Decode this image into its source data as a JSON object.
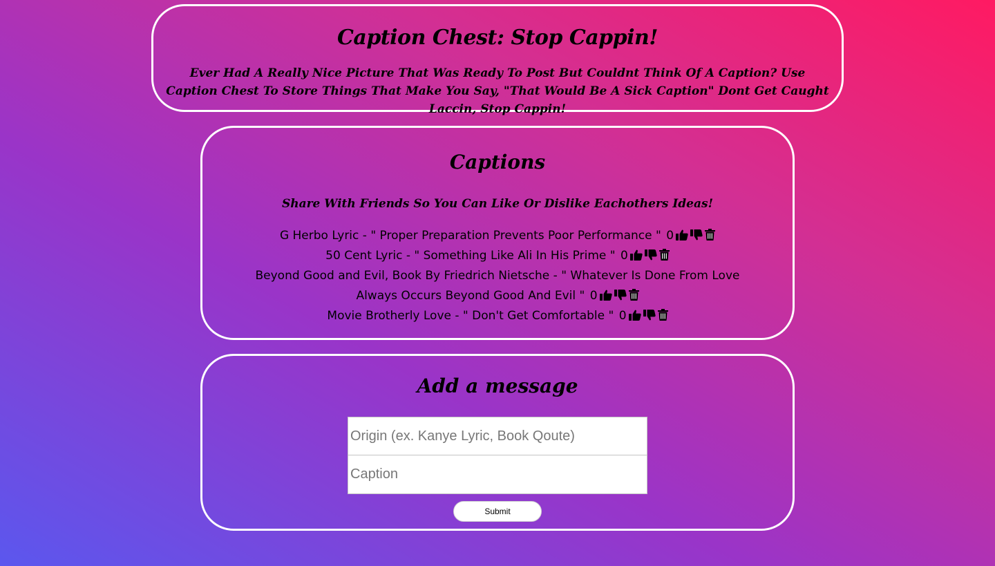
{
  "header": {
    "title": "Caption Chest: Stop Cappin!",
    "tagline": "Ever Had A Really Nice Picture That Was Ready To Post But Couldnt Think Of A Caption? Use Caption Chest To Store Things That Make You Say, \"That Would Be A Sick Caption\" Dont Get Caught Laccin, Stop Cappin!"
  },
  "captions": {
    "title": "Captions",
    "subtitle": "Share With Friends So You Can Like Or Dislike Eachothers Ideas!",
    "items": [
      {
        "origin": "G Herbo Lyric",
        "separator": " - ",
        "text": "\" Proper Preparation Prevents Poor Performance \"",
        "votes": "0"
      },
      {
        "origin": "50 Cent Lyric",
        "separator": " - ",
        "text": "\" Something Like Ali In His Prime \"",
        "votes": "0"
      },
      {
        "origin": "Beyond Good and Evil, Book By Friedrich Nietsche",
        "separator": " - ",
        "text": "\" Whatever Is Done From Love Always Occurs Beyond Good And Evil \"",
        "votes": "0"
      },
      {
        "origin": "Movie Brotherly Love",
        "separator": " - ",
        "text": "\" Don't Get Comfortable \"",
        "votes": "0"
      }
    ],
    "icons": {
      "like": "thumbs-up-icon",
      "dislike": "thumbs-down-icon",
      "delete": "trash-icon"
    }
  },
  "form": {
    "title": "Add a message",
    "origin_placeholder": "Origin (ex. Kanye Lyric, Book Qoute)",
    "caption_placeholder": "Caption",
    "submit_label": "Submit"
  },
  "colors": {
    "gradient_start": "#5b57ee",
    "gradient_mid": "#9a34c8",
    "gradient_end": "#ff1a62",
    "panel_border": "#ffffff"
  }
}
